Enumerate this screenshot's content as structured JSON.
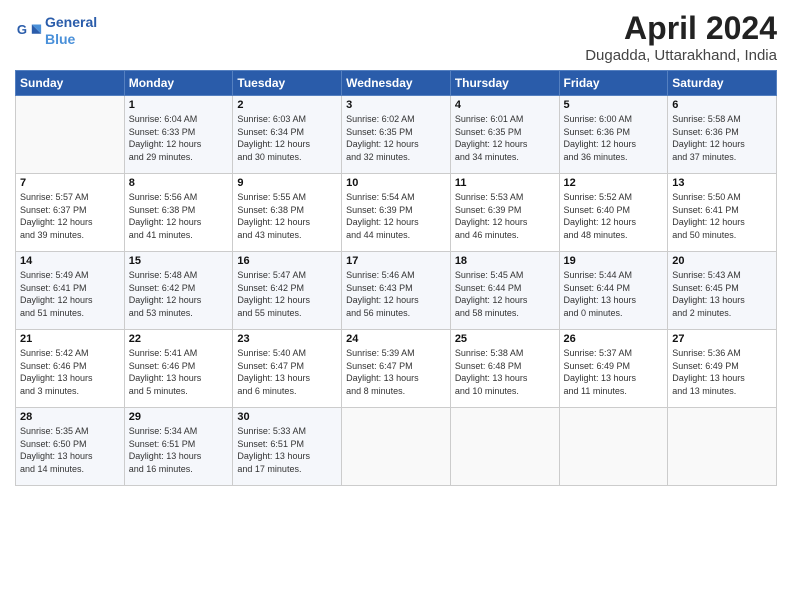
{
  "logo": {
    "line1": "General",
    "line2": "Blue"
  },
  "title": "April 2024",
  "location": "Dugadda, Uttarakhand, India",
  "days_of_week": [
    "Sunday",
    "Monday",
    "Tuesday",
    "Wednesday",
    "Thursday",
    "Friday",
    "Saturday"
  ],
  "weeks": [
    [
      {
        "day": "",
        "info": ""
      },
      {
        "day": "1",
        "info": "Sunrise: 6:04 AM\nSunset: 6:33 PM\nDaylight: 12 hours\nand 29 minutes."
      },
      {
        "day": "2",
        "info": "Sunrise: 6:03 AM\nSunset: 6:34 PM\nDaylight: 12 hours\nand 30 minutes."
      },
      {
        "day": "3",
        "info": "Sunrise: 6:02 AM\nSunset: 6:35 PM\nDaylight: 12 hours\nand 32 minutes."
      },
      {
        "day": "4",
        "info": "Sunrise: 6:01 AM\nSunset: 6:35 PM\nDaylight: 12 hours\nand 34 minutes."
      },
      {
        "day": "5",
        "info": "Sunrise: 6:00 AM\nSunset: 6:36 PM\nDaylight: 12 hours\nand 36 minutes."
      },
      {
        "day": "6",
        "info": "Sunrise: 5:58 AM\nSunset: 6:36 PM\nDaylight: 12 hours\nand 37 minutes."
      }
    ],
    [
      {
        "day": "7",
        "info": "Sunrise: 5:57 AM\nSunset: 6:37 PM\nDaylight: 12 hours\nand 39 minutes."
      },
      {
        "day": "8",
        "info": "Sunrise: 5:56 AM\nSunset: 6:38 PM\nDaylight: 12 hours\nand 41 minutes."
      },
      {
        "day": "9",
        "info": "Sunrise: 5:55 AM\nSunset: 6:38 PM\nDaylight: 12 hours\nand 43 minutes."
      },
      {
        "day": "10",
        "info": "Sunrise: 5:54 AM\nSunset: 6:39 PM\nDaylight: 12 hours\nand 44 minutes."
      },
      {
        "day": "11",
        "info": "Sunrise: 5:53 AM\nSunset: 6:39 PM\nDaylight: 12 hours\nand 46 minutes."
      },
      {
        "day": "12",
        "info": "Sunrise: 5:52 AM\nSunset: 6:40 PM\nDaylight: 12 hours\nand 48 minutes."
      },
      {
        "day": "13",
        "info": "Sunrise: 5:50 AM\nSunset: 6:41 PM\nDaylight: 12 hours\nand 50 minutes."
      }
    ],
    [
      {
        "day": "14",
        "info": "Sunrise: 5:49 AM\nSunset: 6:41 PM\nDaylight: 12 hours\nand 51 minutes."
      },
      {
        "day": "15",
        "info": "Sunrise: 5:48 AM\nSunset: 6:42 PM\nDaylight: 12 hours\nand 53 minutes."
      },
      {
        "day": "16",
        "info": "Sunrise: 5:47 AM\nSunset: 6:42 PM\nDaylight: 12 hours\nand 55 minutes."
      },
      {
        "day": "17",
        "info": "Sunrise: 5:46 AM\nSunset: 6:43 PM\nDaylight: 12 hours\nand 56 minutes."
      },
      {
        "day": "18",
        "info": "Sunrise: 5:45 AM\nSunset: 6:44 PM\nDaylight: 12 hours\nand 58 minutes."
      },
      {
        "day": "19",
        "info": "Sunrise: 5:44 AM\nSunset: 6:44 PM\nDaylight: 13 hours\nand 0 minutes."
      },
      {
        "day": "20",
        "info": "Sunrise: 5:43 AM\nSunset: 6:45 PM\nDaylight: 13 hours\nand 2 minutes."
      }
    ],
    [
      {
        "day": "21",
        "info": "Sunrise: 5:42 AM\nSunset: 6:46 PM\nDaylight: 13 hours\nand 3 minutes."
      },
      {
        "day": "22",
        "info": "Sunrise: 5:41 AM\nSunset: 6:46 PM\nDaylight: 13 hours\nand 5 minutes."
      },
      {
        "day": "23",
        "info": "Sunrise: 5:40 AM\nSunset: 6:47 PM\nDaylight: 13 hours\nand 6 minutes."
      },
      {
        "day": "24",
        "info": "Sunrise: 5:39 AM\nSunset: 6:47 PM\nDaylight: 13 hours\nand 8 minutes."
      },
      {
        "day": "25",
        "info": "Sunrise: 5:38 AM\nSunset: 6:48 PM\nDaylight: 13 hours\nand 10 minutes."
      },
      {
        "day": "26",
        "info": "Sunrise: 5:37 AM\nSunset: 6:49 PM\nDaylight: 13 hours\nand 11 minutes."
      },
      {
        "day": "27",
        "info": "Sunrise: 5:36 AM\nSunset: 6:49 PM\nDaylight: 13 hours\nand 13 minutes."
      }
    ],
    [
      {
        "day": "28",
        "info": "Sunrise: 5:35 AM\nSunset: 6:50 PM\nDaylight: 13 hours\nand 14 minutes."
      },
      {
        "day": "29",
        "info": "Sunrise: 5:34 AM\nSunset: 6:51 PM\nDaylight: 13 hours\nand 16 minutes."
      },
      {
        "day": "30",
        "info": "Sunrise: 5:33 AM\nSunset: 6:51 PM\nDaylight: 13 hours\nand 17 minutes."
      },
      {
        "day": "",
        "info": ""
      },
      {
        "day": "",
        "info": ""
      },
      {
        "day": "",
        "info": ""
      },
      {
        "day": "",
        "info": ""
      }
    ]
  ]
}
